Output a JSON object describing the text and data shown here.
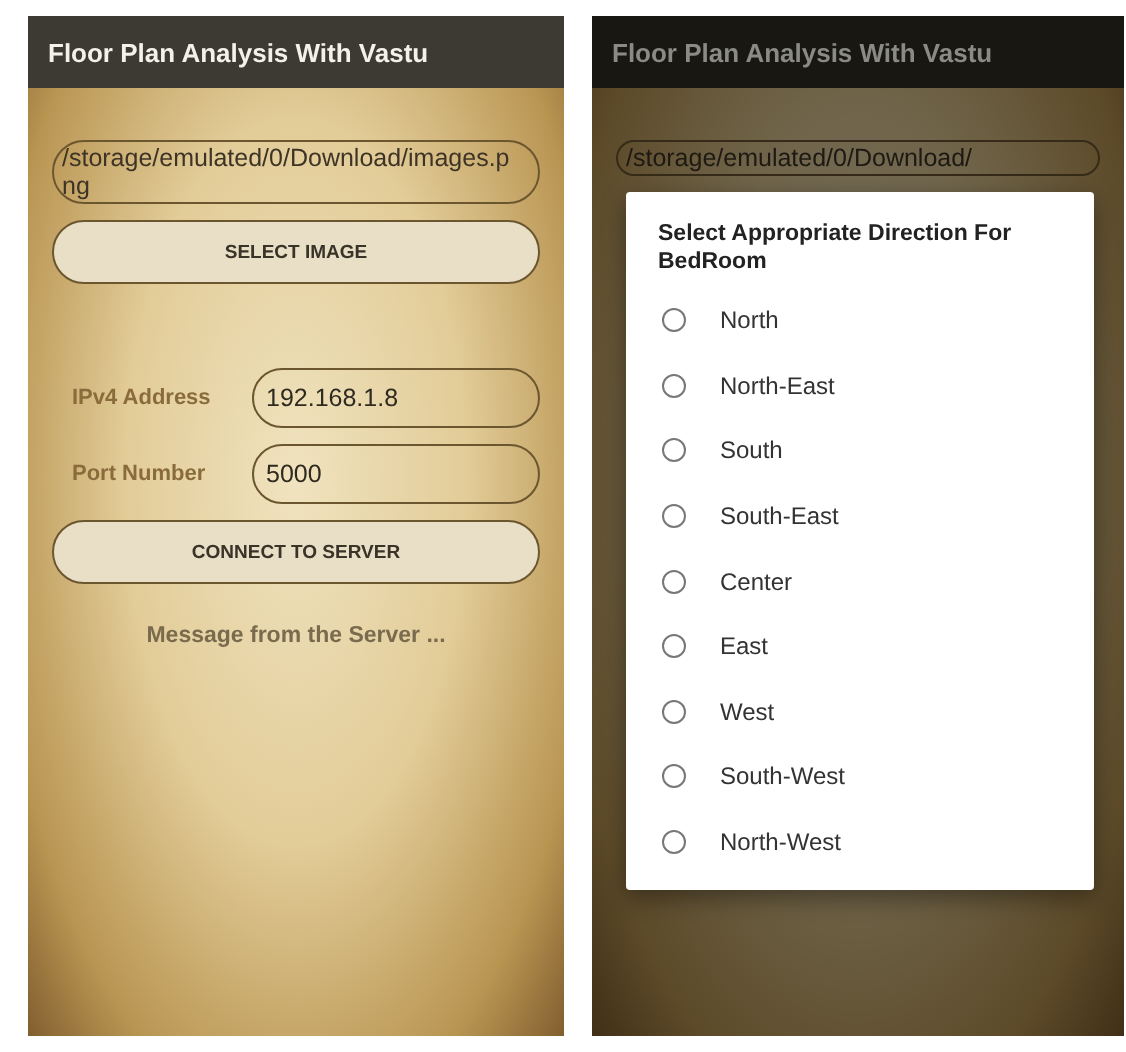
{
  "main_screen": {
    "title": "Floor Plan Analysis With Vastu",
    "file_path": "/storage/emulated/0/Download/images.png",
    "select_button": "SELECT IMAGE",
    "fields": [
      {
        "label": "IPv4 Address",
        "value": "192.168.1.8"
      },
      {
        "label": "Port Number",
        "value": "5000"
      }
    ],
    "connect_button": "CONNECT TO SERVER",
    "message": "Message from the Server ..."
  },
  "dialog_screen": {
    "title": "Floor Plan Analysis With Vastu",
    "file_path": "/storage/emulated/0/Download/",
    "dialog": {
      "title": "Select Appropriate Direction For BedRoom",
      "options": [
        {
          "label": "North",
          "selected": false
        },
        {
          "label": "North-East",
          "selected": false
        },
        {
          "label": "South",
          "selected": false
        },
        {
          "label": "South-East",
          "selected": false
        },
        {
          "label": "Center",
          "selected": false
        },
        {
          "label": "East",
          "selected": false
        },
        {
          "label": "West",
          "selected": false
        },
        {
          "label": "South-West",
          "selected": false
        },
        {
          "label": "North-West",
          "selected": false
        }
      ]
    }
  }
}
